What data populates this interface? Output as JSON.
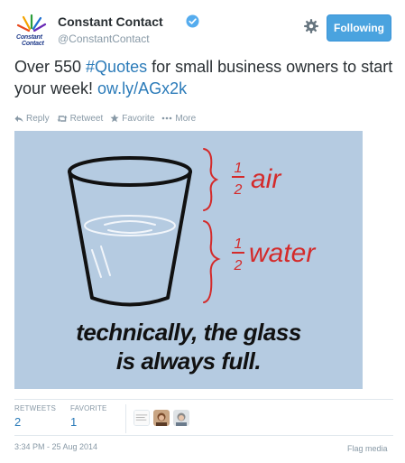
{
  "header": {
    "logo_line1": "Constant",
    "logo_line2": "Contact",
    "user_name": "Constant Contact",
    "user_handle": "@ConstantContact",
    "follow_label": "Following",
    "gear_icon": "gear-icon",
    "verified_icon": "verified-badge-icon"
  },
  "tweet": {
    "text_part1": "Over 550 ",
    "hashtag": "#Quotes",
    "text_part2": " for small business owners to start your week! ",
    "link": "ow.ly/AGx2k"
  },
  "actions": {
    "reply": "Reply",
    "retweet": "Retweet",
    "favorite": "Favorite",
    "more": "More"
  },
  "media": {
    "label_top_num": "1",
    "label_top_den": "2",
    "label_top_word": "air",
    "label_bottom_num": "1",
    "label_bottom_den": "2",
    "label_bottom_word": "water",
    "caption_line1": "technically, the glass",
    "caption_line2": "is always full."
  },
  "stats": {
    "retweets_label": "RETWEETS",
    "retweets_value": "2",
    "favorites_label": "FAVORITE",
    "favorites_value": "1"
  },
  "footer": {
    "timestamp": "3:34 PM - 25 Aug 2014",
    "flag_media": "Flag media"
  },
  "colors": {
    "accent": "#2b7bb9",
    "follow_button": "#4aa3df",
    "media_background": "#b5cbe1",
    "annotation_red": "#d42a2a"
  }
}
